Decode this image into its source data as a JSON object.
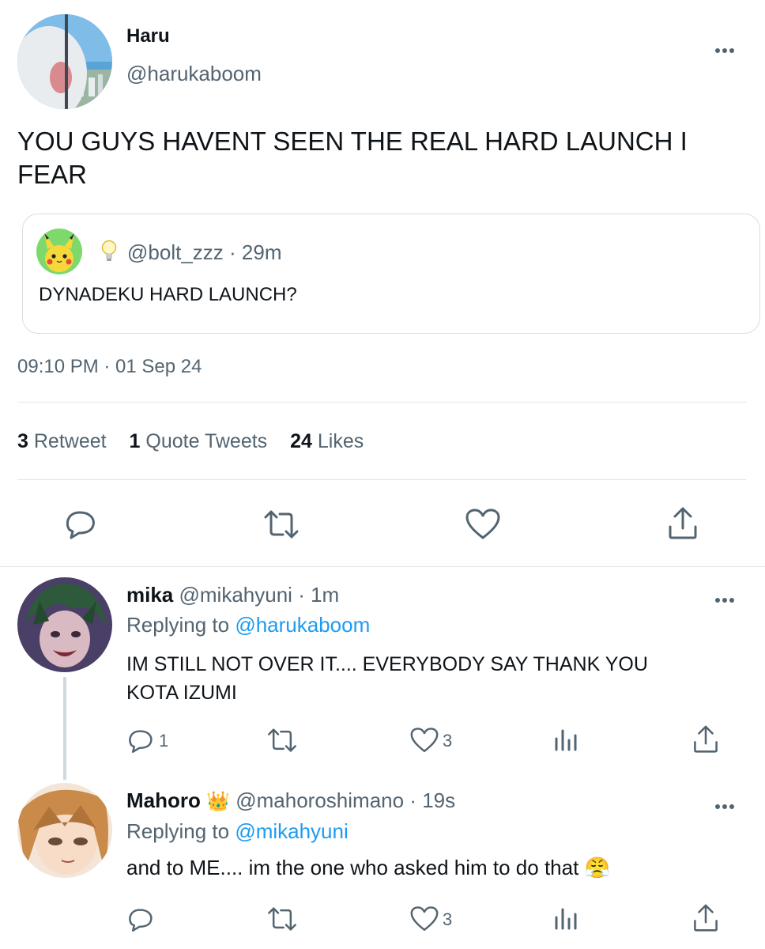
{
  "tweet": {
    "author_name": "Haru",
    "author_handle": "@harukaboom",
    "text_line1": "YOU GUYS HAVENT SEEN THE REAL HARD LAUNCH I",
    "text_line2": "FEAR",
    "quoted": {
      "handle": "@bolt_zzz",
      "separator": "·",
      "time": "29m",
      "text": "DYNADEKU HARD LAUNCH?",
      "badge_icon": "lightbulb-icon"
    },
    "timestamp": "09:10 PM · 01 Sep 24",
    "stats": {
      "retweets_count": "3",
      "retweets_label": "Retweet",
      "quotes_count": "1",
      "quotes_label": "Quote Tweets",
      "likes_count": "24",
      "likes_label": "Likes"
    },
    "actions": [
      "reply-icon",
      "retweet-icon",
      "heart-icon",
      "share-icon"
    ]
  },
  "replies": [
    {
      "name": "mika",
      "handle": "@mikahyuni",
      "separator": "·",
      "time": "1m",
      "replying_prefix": "Replying to",
      "replying_handle": "@harukaboom",
      "text_line1": "IM STILL NOT OVER IT.... EVERYBODY SAY THANK YOU",
      "text_line2": "KOTA IZUMI",
      "reply_count": "1",
      "retweet_count": "",
      "like_count": "3"
    },
    {
      "name": "Mahoro",
      "badge": "👑",
      "handle": "@mahoroshimano",
      "separator": "·",
      "time": "19s",
      "replying_prefix": "Replying to",
      "replying_handle": "@mikahyuni",
      "text": "and to ME.... im the one who asked him to do that",
      "emoji": "😤",
      "reply_count": "",
      "retweet_count": "",
      "like_count": "3"
    }
  ],
  "colors": {
    "text": "#0f1419",
    "secondary": "#536471",
    "link": "#1d9bf0",
    "divider": "#e1e6ea"
  }
}
